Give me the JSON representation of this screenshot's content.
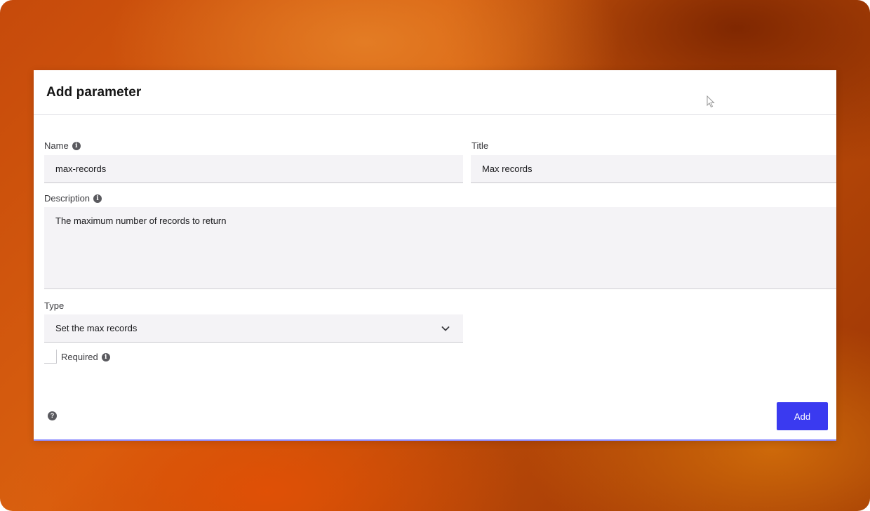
{
  "dialog": {
    "title": "Add parameter"
  },
  "form": {
    "name": {
      "label": "Name",
      "value": "max-records",
      "info_icon": "info-icon"
    },
    "title": {
      "label": "Title",
      "value": "Max records"
    },
    "description": {
      "label": "Description",
      "value": "The maximum number of records to return",
      "info_icon": "info-icon"
    },
    "type": {
      "label": "Type",
      "selected": "Set the max records",
      "icon": "chevron-down-icon"
    },
    "required": {
      "label": "Required",
      "checked": false,
      "info_icon": "info-icon"
    }
  },
  "footer": {
    "help_icon": "help-icon",
    "add_label": "Add"
  },
  "colors": {
    "primary_button": "#3a3af0",
    "input_background": "#f4f3f6"
  }
}
